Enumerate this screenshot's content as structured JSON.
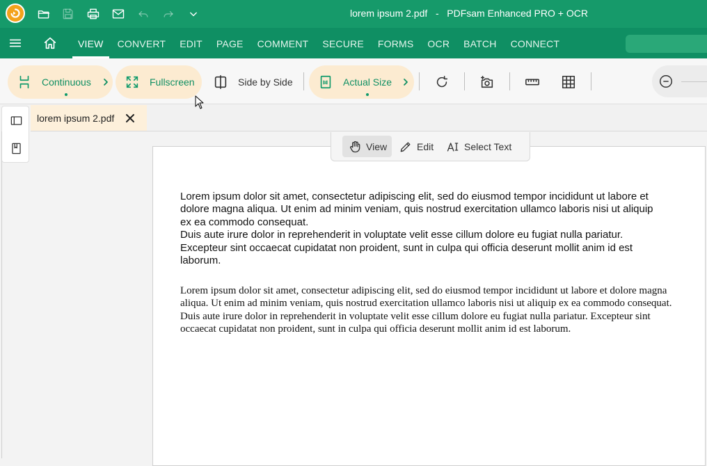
{
  "titlebar": {
    "window_title": "lorem ipsum 2.pdf   -   PDFsam Enhanced PRO + OCR",
    "icons": [
      "app-logo",
      "open-folder-icon",
      "save-icon",
      "print-icon",
      "email-icon",
      "undo-icon",
      "redo-icon",
      "chevron-down-icon"
    ]
  },
  "menu": {
    "tabs": [
      "VIEW",
      "CONVERT",
      "EDIT",
      "PAGE",
      "COMMENT",
      "SECURE",
      "FORMS",
      "OCR",
      "BATCH",
      "CONNECT"
    ],
    "active_tab": "VIEW"
  },
  "toolbar": {
    "continuous_label": "Continuous",
    "fullscreen_label": "Fullscreen",
    "side_by_side_label": "Side by Side",
    "actual_size_label": "Actual Size"
  },
  "document_tab": {
    "label": "lorem ipsum 2.pdf"
  },
  "modebar": {
    "view_label": "View",
    "edit_label": "Edit",
    "select_text_label": "Select Text",
    "active": "View"
  },
  "document": {
    "paragraph_sans_lines": [
      "Lorem ipsum dolor sit amet, consectetur adipiscing elit, sed do eiusmod tempor incididunt ut labore et",
      "dolore magna aliqua. Ut enim ad minim veniam, quis nostrud exercitation ullamco laboris nisi ut aliquip",
      "ex ea commodo consequat.",
      "Duis aute irure dolor in reprehenderit in voluptate velit esse cillum dolore eu fugiat nulla pariatur.",
      "Excepteur sint occaecat cupidatat non proident, sunt in culpa qui officia deserunt mollit anim id est",
      "laborum."
    ],
    "paragraph_serif": "Lorem ipsum dolor sit amet, consectetur adipiscing elit, sed do eiusmod tempor incididunt ut labore et dolore magna aliqua. Ut enim ad minim veniam, quis nostrud exercitation ullamco laboris nisi ut aliquip ex ea commodo consequat. Duis aute irure dolor in reprehenderit in voluptate velit esse cillum dolore eu fugiat nulla pariatur. Excepteur sint occaecat cupidatat non proident, sunt in culpa qui officia deserunt mollit anim id est laborum."
  },
  "colors": {
    "titlebar_bg": "#169a6a",
    "menubar_bg": "#0f8f63",
    "accent": "#109a6b",
    "pill_bg": "#fcebd1",
    "logo_orange": "#f3a21b"
  }
}
